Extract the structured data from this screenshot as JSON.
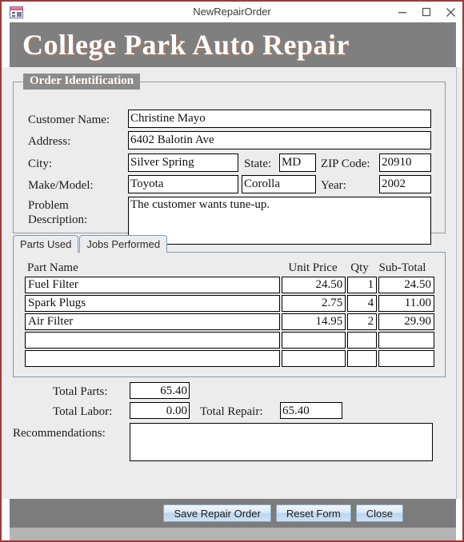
{
  "window": {
    "title": "NewRepairOrder",
    "icon": "access-form-icon",
    "border_color": "#9c3a3a",
    "controls": [
      {
        "name": "minimize-button",
        "glyph": "minimize"
      },
      {
        "name": "maximize-button",
        "glyph": "maximize"
      },
      {
        "name": "close-button",
        "glyph": "close"
      }
    ]
  },
  "banner": {
    "title": "College Park Auto Repair",
    "background": "#807f7f",
    "text_color": "#ffffff"
  },
  "order_identification": {
    "legend": "Order Identification",
    "fields": {
      "customer_name_label": "Customer Name:",
      "customer_name_value": "Christine Mayo",
      "address_label": "Address:",
      "address_value": "6402 Balotin Ave",
      "city_label": "City:",
      "city_value": "Silver Spring",
      "state_label": "State:",
      "state_value": "MD",
      "zip_label": "ZIP Code:",
      "zip_value": "20910",
      "make_model_label": "Make/Model:",
      "make_value": "Toyota",
      "model_value": "Corolla",
      "year_label": "Year:",
      "year_value": "2002",
      "problem_label_line1": "Problem",
      "problem_label_line2": "Description:",
      "problem_value": "The customer wants tune-up."
    }
  },
  "tabs": [
    {
      "label": "Parts Used",
      "active": true
    },
    {
      "label": "Jobs Performed",
      "active": false
    }
  ],
  "parts_table": {
    "headers": {
      "part_name": "Part Name",
      "unit_price": "Unit Price",
      "qty": "Qty",
      "sub_total": "Sub-Total"
    },
    "rows": [
      {
        "part_name": "Fuel Filter",
        "unit_price": "24.50",
        "qty": "1",
        "sub_total": "24.50"
      },
      {
        "part_name": "Spark Plugs",
        "unit_price": "2.75",
        "qty": "4",
        "sub_total": "11.00"
      },
      {
        "part_name": "Air Filter",
        "unit_price": "14.95",
        "qty": "2",
        "sub_total": "29.90"
      },
      {
        "part_name": "",
        "unit_price": "",
        "qty": "",
        "sub_total": ""
      },
      {
        "part_name": "",
        "unit_price": "",
        "qty": "",
        "sub_total": ""
      }
    ]
  },
  "totals": {
    "total_parts_label": "Total Parts:",
    "total_parts_value": "65.40",
    "total_labor_label": "Total Labor:",
    "total_labor_value": "0.00",
    "total_repair_label": "Total Repair:",
    "total_repair_value": "65.40",
    "recommendations_label": "Recommendations:",
    "recommendations_value": ""
  },
  "footer": {
    "save_label": "Save Repair Order",
    "reset_label": "Reset Form",
    "close_label": "Close",
    "background": "#7d7c7c"
  }
}
